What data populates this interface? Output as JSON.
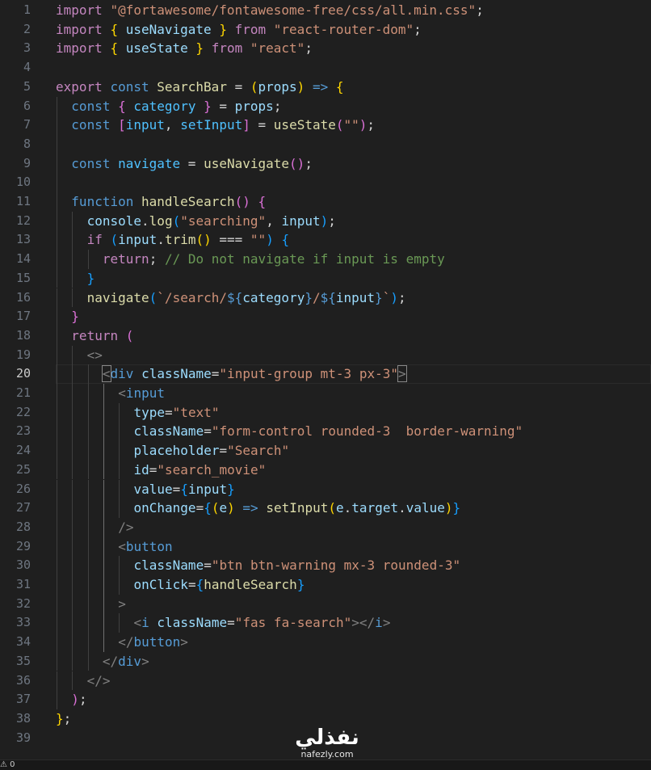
{
  "editor": {
    "active_line": 20,
    "lines": [
      {
        "n": "1",
        "indent": 0,
        "tokens": [
          [
            "kw",
            "import"
          ],
          [
            "txt",
            " "
          ],
          [
            "str",
            "\"@fortawesome/fontawesome-free/css/all.min.css\""
          ],
          [
            "txt",
            ";"
          ]
        ]
      },
      {
        "n": "2",
        "indent": 0,
        "tokens": [
          [
            "kw",
            "import"
          ],
          [
            "txt",
            " "
          ],
          [
            "b1",
            "{"
          ],
          [
            "txt",
            " "
          ],
          [
            "var",
            "useNavigate"
          ],
          [
            "txt",
            " "
          ],
          [
            "b1",
            "}"
          ],
          [
            "txt",
            " "
          ],
          [
            "kw",
            "from"
          ],
          [
            "txt",
            " "
          ],
          [
            "str",
            "\"react-router-dom\""
          ],
          [
            "txt",
            ";"
          ]
        ]
      },
      {
        "n": "3",
        "indent": 0,
        "tokens": [
          [
            "kw",
            "import"
          ],
          [
            "txt",
            " "
          ],
          [
            "b1",
            "{"
          ],
          [
            "txt",
            " "
          ],
          [
            "var",
            "useState"
          ],
          [
            "txt",
            " "
          ],
          [
            "b1",
            "}"
          ],
          [
            "txt",
            " "
          ],
          [
            "kw",
            "from"
          ],
          [
            "txt",
            " "
          ],
          [
            "str",
            "\"react\""
          ],
          [
            "txt",
            ";"
          ]
        ]
      },
      {
        "n": "4",
        "indent": 0,
        "tokens": []
      },
      {
        "n": "5",
        "indent": 0,
        "tokens": [
          [
            "kw",
            "export"
          ],
          [
            "txt",
            " "
          ],
          [
            "decl",
            "const"
          ],
          [
            "txt",
            " "
          ],
          [
            "fn",
            "SearchBar"
          ],
          [
            "txt",
            " = "
          ],
          [
            "b1",
            "("
          ],
          [
            "var",
            "props"
          ],
          [
            "b1",
            ")"
          ],
          [
            "txt",
            " "
          ],
          [
            "decl",
            "=>"
          ],
          [
            "txt",
            " "
          ],
          [
            "b1",
            "{"
          ]
        ]
      },
      {
        "n": "6",
        "indent": 1,
        "tokens": [
          [
            "decl",
            "const"
          ],
          [
            "txt",
            " "
          ],
          [
            "b2",
            "{"
          ],
          [
            "txt",
            " "
          ],
          [
            "const",
            "category"
          ],
          [
            "txt",
            " "
          ],
          [
            "b2",
            "}"
          ],
          [
            "txt",
            " = "
          ],
          [
            "var",
            "props"
          ],
          [
            "txt",
            ";"
          ]
        ]
      },
      {
        "n": "7",
        "indent": 1,
        "tokens": [
          [
            "decl",
            "const"
          ],
          [
            "txt",
            " "
          ],
          [
            "b2",
            "["
          ],
          [
            "const",
            "input"
          ],
          [
            "txt",
            ", "
          ],
          [
            "const",
            "setInput"
          ],
          [
            "b2",
            "]"
          ],
          [
            "txt",
            " = "
          ],
          [
            "fn",
            "useState"
          ],
          [
            "b2",
            "("
          ],
          [
            "str",
            "\"\""
          ],
          [
            "b2",
            ")"
          ],
          [
            "txt",
            ";"
          ]
        ]
      },
      {
        "n": "8",
        "indent": 1,
        "tokens": []
      },
      {
        "n": "9",
        "indent": 1,
        "tokens": [
          [
            "decl",
            "const"
          ],
          [
            "txt",
            " "
          ],
          [
            "const",
            "navigate"
          ],
          [
            "txt",
            " = "
          ],
          [
            "fn",
            "useNavigate"
          ],
          [
            "b2",
            "()"
          ],
          [
            "txt",
            ";"
          ]
        ]
      },
      {
        "n": "10",
        "indent": 1,
        "tokens": []
      },
      {
        "n": "11",
        "indent": 1,
        "tokens": [
          [
            "decl",
            "function"
          ],
          [
            "txt",
            " "
          ],
          [
            "fn",
            "handleSearch"
          ],
          [
            "b2",
            "()"
          ],
          [
            "txt",
            " "
          ],
          [
            "b2",
            "{"
          ]
        ]
      },
      {
        "n": "12",
        "indent": 2,
        "tokens": [
          [
            "var",
            "console"
          ],
          [
            "txt",
            "."
          ],
          [
            "fn",
            "log"
          ],
          [
            "b3",
            "("
          ],
          [
            "str",
            "\"searching\""
          ],
          [
            "txt",
            ", "
          ],
          [
            "var",
            "input"
          ],
          [
            "b3",
            ")"
          ],
          [
            "txt",
            ";"
          ]
        ]
      },
      {
        "n": "13",
        "indent": 2,
        "tokens": [
          [
            "kw",
            "if"
          ],
          [
            "txt",
            " "
          ],
          [
            "b3",
            "("
          ],
          [
            "var",
            "input"
          ],
          [
            "txt",
            "."
          ],
          [
            "fn",
            "trim"
          ],
          [
            "b1",
            "()"
          ],
          [
            "txt",
            " === "
          ],
          [
            "str",
            "\"\""
          ],
          [
            "b3",
            ")"
          ],
          [
            "txt",
            " "
          ],
          [
            "b3",
            "{"
          ]
        ]
      },
      {
        "n": "14",
        "indent": 3,
        "tokens": [
          [
            "kw",
            "return"
          ],
          [
            "txt",
            "; "
          ],
          [
            "cmt",
            "// Do not navigate if input is empty"
          ]
        ]
      },
      {
        "n": "15",
        "indent": 2,
        "tokens": [
          [
            "b3",
            "}"
          ]
        ]
      },
      {
        "n": "16",
        "indent": 2,
        "tokens": [
          [
            "fn",
            "navigate"
          ],
          [
            "b3",
            "("
          ],
          [
            "str",
            "`/search/"
          ],
          [
            "decl",
            "${"
          ],
          [
            "var",
            "category"
          ],
          [
            "decl",
            "}"
          ],
          [
            "str",
            "/"
          ],
          [
            "decl",
            "${"
          ],
          [
            "var",
            "input"
          ],
          [
            "decl",
            "}"
          ],
          [
            "str",
            "`"
          ],
          [
            "b3",
            ")"
          ],
          [
            "txt",
            ";"
          ]
        ]
      },
      {
        "n": "17",
        "indent": 1,
        "tokens": [
          [
            "b2",
            "}"
          ]
        ]
      },
      {
        "n": "18",
        "indent": 1,
        "tokens": [
          [
            "kw",
            "return"
          ],
          [
            "txt",
            " "
          ],
          [
            "b2",
            "("
          ]
        ]
      },
      {
        "n": "19",
        "indent": 2,
        "tokens": [
          [
            "tag",
            "<>"
          ]
        ]
      },
      {
        "n": "20",
        "indent": 3,
        "tokens": [
          [
            "tagm",
            "<"
          ],
          [
            "tagname",
            "div"
          ],
          [
            "txt",
            " "
          ],
          [
            "attr",
            "className"
          ],
          [
            "txt",
            "="
          ],
          [
            "str",
            "\"input-group mt-3 px-3\""
          ],
          [
            "tagm",
            ">"
          ]
        ]
      },
      {
        "n": "21",
        "indent": 4,
        "tokens": [
          [
            "tag",
            "<"
          ],
          [
            "tagname",
            "input"
          ]
        ]
      },
      {
        "n": "22",
        "indent": 5,
        "tokens": [
          [
            "attr",
            "type"
          ],
          [
            "txt",
            "="
          ],
          [
            "str",
            "\"text\""
          ]
        ]
      },
      {
        "n": "23",
        "indent": 5,
        "tokens": [
          [
            "attr",
            "className"
          ],
          [
            "txt",
            "="
          ],
          [
            "str",
            "\"form-control rounded-3  border-warning\""
          ]
        ]
      },
      {
        "n": "24",
        "indent": 5,
        "tokens": [
          [
            "attr",
            "placeholder"
          ],
          [
            "txt",
            "="
          ],
          [
            "str",
            "\"Search\""
          ]
        ]
      },
      {
        "n": "25",
        "indent": 5,
        "tokens": [
          [
            "attr",
            "id"
          ],
          [
            "txt",
            "="
          ],
          [
            "str",
            "\"search_movie\""
          ]
        ]
      },
      {
        "n": "26",
        "indent": 5,
        "tokens": [
          [
            "attr",
            "value"
          ],
          [
            "txt",
            "="
          ],
          [
            "b3",
            "{"
          ],
          [
            "var",
            "input"
          ],
          [
            "b3",
            "}"
          ]
        ]
      },
      {
        "n": "27",
        "indent": 5,
        "tokens": [
          [
            "attr",
            "onChange"
          ],
          [
            "txt",
            "="
          ],
          [
            "b3",
            "{"
          ],
          [
            "b1",
            "("
          ],
          [
            "var",
            "e"
          ],
          [
            "b1",
            ")"
          ],
          [
            "txt",
            " "
          ],
          [
            "decl",
            "=>"
          ],
          [
            "txt",
            " "
          ],
          [
            "fn",
            "setInput"
          ],
          [
            "b1",
            "("
          ],
          [
            "var",
            "e"
          ],
          [
            "txt",
            "."
          ],
          [
            "var",
            "target"
          ],
          [
            "txt",
            "."
          ],
          [
            "var",
            "value"
          ],
          [
            "b1",
            ")"
          ],
          [
            "b3",
            "}"
          ]
        ]
      },
      {
        "n": "28",
        "indent": 4,
        "tokens": [
          [
            "tag",
            "/>"
          ]
        ]
      },
      {
        "n": "29",
        "indent": 4,
        "tokens": [
          [
            "tag",
            "<"
          ],
          [
            "tagname",
            "button"
          ]
        ]
      },
      {
        "n": "30",
        "indent": 5,
        "tokens": [
          [
            "attr",
            "className"
          ],
          [
            "txt",
            "="
          ],
          [
            "str",
            "\"btn btn-warning mx-3 rounded-3\""
          ]
        ]
      },
      {
        "n": "31",
        "indent": 5,
        "tokens": [
          [
            "attr",
            "onClick"
          ],
          [
            "txt",
            "="
          ],
          [
            "b3",
            "{"
          ],
          [
            "fn",
            "handleSearch"
          ],
          [
            "b3",
            "}"
          ]
        ]
      },
      {
        "n": "32",
        "indent": 4,
        "tokens": [
          [
            "tag",
            ">"
          ]
        ]
      },
      {
        "n": "33",
        "indent": 5,
        "tokens": [
          [
            "tag",
            "<"
          ],
          [
            "tagname",
            "i"
          ],
          [
            "txt",
            " "
          ],
          [
            "attr",
            "className"
          ],
          [
            "txt",
            "="
          ],
          [
            "str",
            "\"fas fa-search\""
          ],
          [
            "tag",
            "></"
          ],
          [
            "tagname",
            "i"
          ],
          [
            "tag",
            ">"
          ]
        ]
      },
      {
        "n": "34",
        "indent": 4,
        "tokens": [
          [
            "tag",
            "</"
          ],
          [
            "tagname",
            "button"
          ],
          [
            "tag",
            ">"
          ]
        ]
      },
      {
        "n": "35",
        "indent": 3,
        "tokens": [
          [
            "tag",
            "</"
          ],
          [
            "tagname",
            "div"
          ],
          [
            "tag",
            ">"
          ]
        ]
      },
      {
        "n": "36",
        "indent": 2,
        "tokens": [
          [
            "tag",
            "</>"
          ]
        ]
      },
      {
        "n": "37",
        "indent": 1,
        "tokens": [
          [
            "b2",
            ")"
          ],
          [
            "txt",
            ";"
          ]
        ]
      },
      {
        "n": "38",
        "indent": 0,
        "tokens": [
          [
            "b1",
            "}"
          ],
          [
            "txt",
            ";"
          ]
        ]
      },
      {
        "n": "39",
        "indent": 0,
        "tokens": []
      }
    ]
  },
  "colors": {
    "background": "#1f1f1f",
    "keyword": "#c586c0",
    "declaration": "#569cd6",
    "string": "#ce9178",
    "function": "#dcdcaa",
    "variable": "#9cdcfe",
    "constant": "#4fc1ff",
    "comment": "#6a9955"
  },
  "watermark": {
    "arabic": "نفذلي",
    "latin": "nafezly.com"
  },
  "status_bar": {
    "warnings": "⚠ 0"
  }
}
